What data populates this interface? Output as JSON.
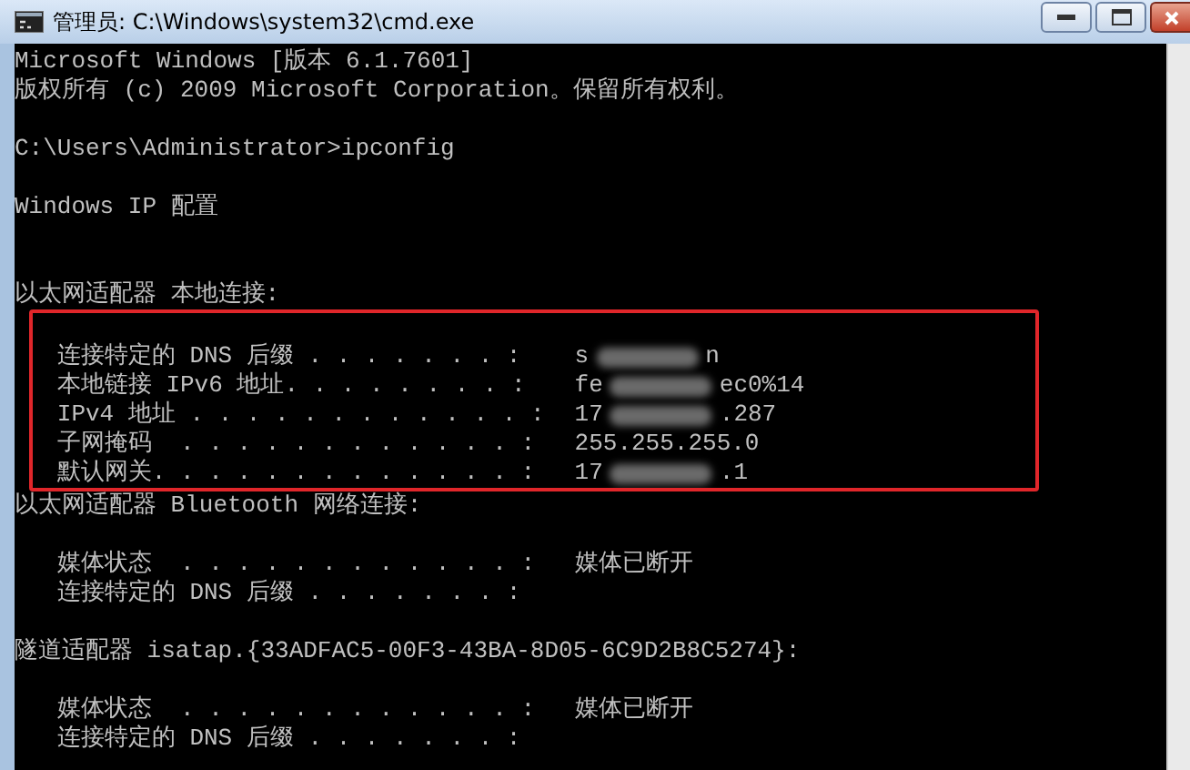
{
  "window": {
    "title": "管理员: C:\\Windows\\system32\\cmd.exe"
  },
  "console": {
    "lines": [
      {
        "kind": "text",
        "text": "Microsoft Windows [版本 6.1.7601]"
      },
      {
        "kind": "text",
        "text": "版权所有 (c) 2009 Microsoft Corporation。保留所有权利。"
      },
      {
        "kind": "blank"
      },
      {
        "kind": "text",
        "text": "C:\\Users\\Administrator>ipconfig"
      },
      {
        "kind": "blank"
      },
      {
        "kind": "text",
        "text": "Windows IP 配置"
      },
      {
        "kind": "blank"
      },
      {
        "kind": "blank"
      },
      {
        "kind": "text",
        "text": "以太网适配器 本地连接:"
      },
      {
        "kind": "highlight",
        "lines": [
          {
            "kind": "blank"
          },
          {
            "kind": "redacted",
            "label": "   连接特定的 DNS 后缀 . . . . . . . :",
            "value_start": "s",
            "value_end": "n"
          },
          {
            "kind": "redacted",
            "label": "   本地链接 IPv6 地址. . . . . . . . :",
            "value_start": "fe",
            "value_end": "ec0%14"
          },
          {
            "kind": "redacted",
            "label": "   IPv4 地址 . . . . . . . . . . . . :",
            "value_start": "17",
            "value_end": ".287"
          },
          {
            "kind": "entry",
            "label": "   子网掩码  . . . . . . . . . . . . :",
            "value": "255.255.255.0"
          },
          {
            "kind": "redacted",
            "label": "   默认网关. . . . . . . . . . . . . :",
            "value_start": "17",
            "value_end": ".1"
          }
        ]
      },
      {
        "kind": "text",
        "text": "以太网适配器 Bluetooth 网络连接:"
      },
      {
        "kind": "blank"
      },
      {
        "kind": "entry",
        "label": "   媒体状态  . . . . . . . . . . . . :",
        "value": "媒体已断开"
      },
      {
        "kind": "entry",
        "label": "   连接特定的 DNS 后缀 . . . . . . . :"
      },
      {
        "kind": "blank"
      },
      {
        "kind": "text",
        "text": "隧道适配器 isatap.{33ADFAC5-00F3-43BA-8D05-6C9D2B8C5274}:"
      },
      {
        "kind": "blank"
      },
      {
        "kind": "entry",
        "label": "   媒体状态  . . . . . . . . . . . . :",
        "value": "媒体已断开"
      },
      {
        "kind": "entry",
        "label": "   连接特定的 DNS 后缀 . . . . . . . :"
      }
    ]
  }
}
